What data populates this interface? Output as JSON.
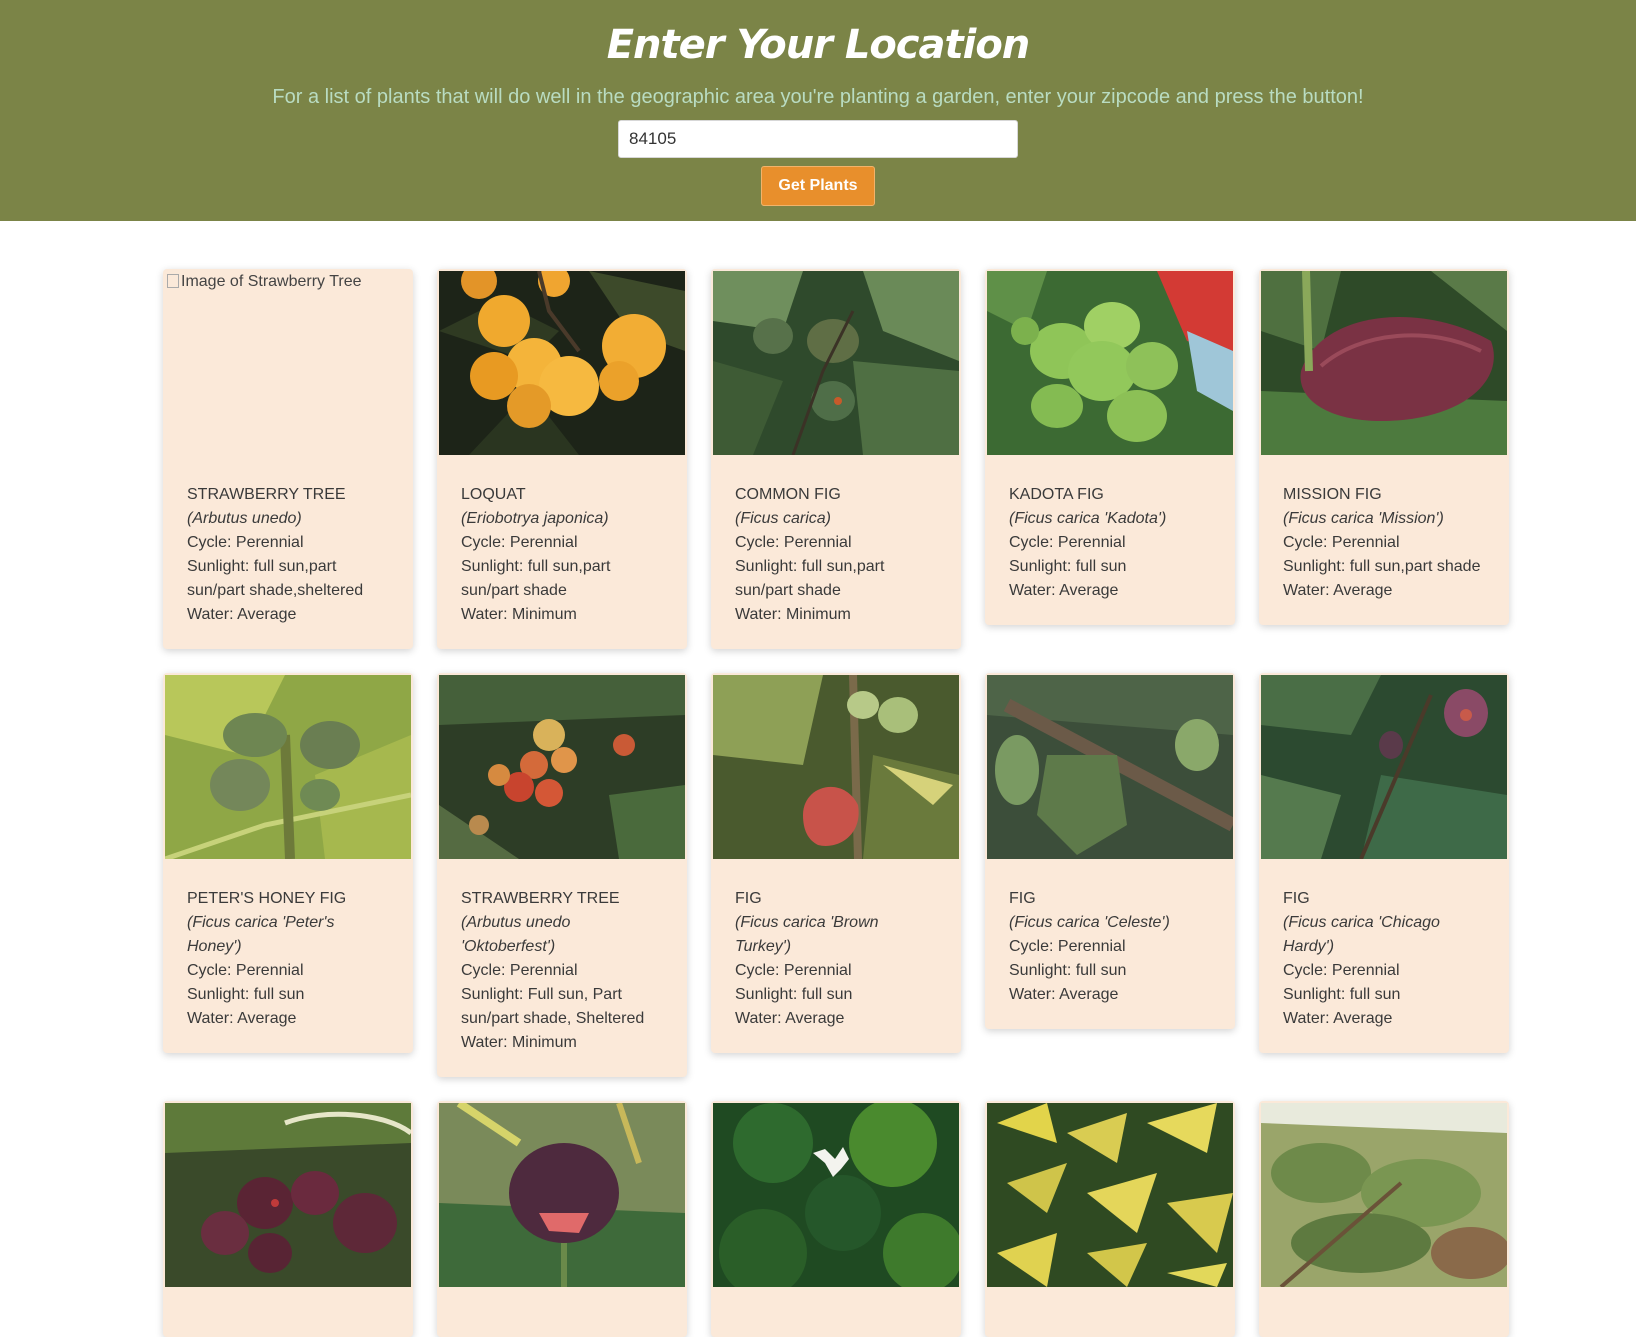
{
  "header": {
    "title": "Enter Your Location",
    "subtitle": "For a list of plants that will do well in the geographic area you're planting a garden, enter your zipcode and press the button!",
    "zip_value": "84105",
    "button_label": "Get Plants"
  },
  "colors": {
    "header_bg": "#7b8447",
    "subtitle": "#b9dcc2",
    "button": "#e88f2c",
    "card_bg": "#fbe9d9"
  },
  "plants": [
    {
      "name": "STRAWBERRY TREE",
      "sci": "(Arbutus unedo)",
      "cycle": "Cycle: Perennial",
      "sun": "Sunlight: full sun,part sun/part shade,sheltered",
      "water": "Water: Average",
      "alt": "Image of Strawberry Tree",
      "image": "broken"
    },
    {
      "name": "LOQUAT",
      "sci": "(Eriobotrya japonica)",
      "cycle": "Cycle: Perennial",
      "sun": "Sunlight: full sun,part sun/part shade",
      "water": "Water: Minimum",
      "image": "loquat-fruit"
    },
    {
      "name": "COMMON FIG",
      "sci": "(Ficus carica)",
      "cycle": "Cycle: Perennial",
      "sun": "Sunlight: full sun,part sun/part shade",
      "water": "Water: Minimum",
      "image": "fig-leaves"
    },
    {
      "name": "KADOTA FIG",
      "sci": "(Ficus carica 'Kadota')",
      "cycle": "Cycle: Perennial",
      "sun": "Sunlight: full sun",
      "water": "Water: Average",
      "image": "green-figs"
    },
    {
      "name": "MISSION FIG",
      "sci": "(Ficus carica 'Mission')",
      "cycle": "Cycle: Perennial",
      "sun": "Sunlight: full sun,part shade",
      "water": "Water: Average",
      "image": "purple-fig"
    },
    {
      "name": "PETER'S HONEY FIG",
      "sci": "(Ficus carica 'Peter's Honey')",
      "cycle": "Cycle: Perennial",
      "sun": "Sunlight: full sun",
      "water": "Water: Average",
      "image": "honey-figs"
    },
    {
      "name": "STRAWBERRY TREE",
      "sci": "(Arbutus unedo 'Oktoberfest')",
      "cycle": "Cycle: Perennial",
      "sun": "Sunlight: Full sun, Part sun/part shade, Sheltered",
      "water": "Water: Minimum",
      "image": "red-berries"
    },
    {
      "name": "FIG",
      "sci": "(Ficus carica 'Brown Turkey')",
      "cycle": "Cycle: Perennial",
      "sun": "Sunlight: full sun",
      "water": "Water: Average",
      "image": "brown-turkey"
    },
    {
      "name": "FIG",
      "sci": "(Ficus carica 'Celeste')",
      "cycle": "Cycle: Perennial",
      "sun": "Sunlight: full sun",
      "water": "Water: Average",
      "image": "celeste"
    },
    {
      "name": "FIG",
      "sci": "(Ficus carica 'Chicago Hardy')",
      "cycle": "Cycle: Perennial",
      "sun": "Sunlight: full sun",
      "water": "Water: Average",
      "image": "chicago-hardy"
    },
    {
      "name": "",
      "sci": "",
      "cycle": "",
      "sun": "",
      "water": "",
      "image": "dark-figs"
    },
    {
      "name": "",
      "sci": "",
      "cycle": "",
      "sun": "",
      "water": "",
      "image": "split-fig"
    },
    {
      "name": "",
      "sci": "",
      "cycle": "",
      "sun": "",
      "water": "",
      "image": "clover-flower"
    },
    {
      "name": "",
      "sci": "",
      "cycle": "",
      "sun": "",
      "water": "",
      "image": "variegated-leaves"
    },
    {
      "name": "",
      "sci": "",
      "cycle": "",
      "sun": "",
      "water": "",
      "image": "tree-canopy"
    }
  ]
}
